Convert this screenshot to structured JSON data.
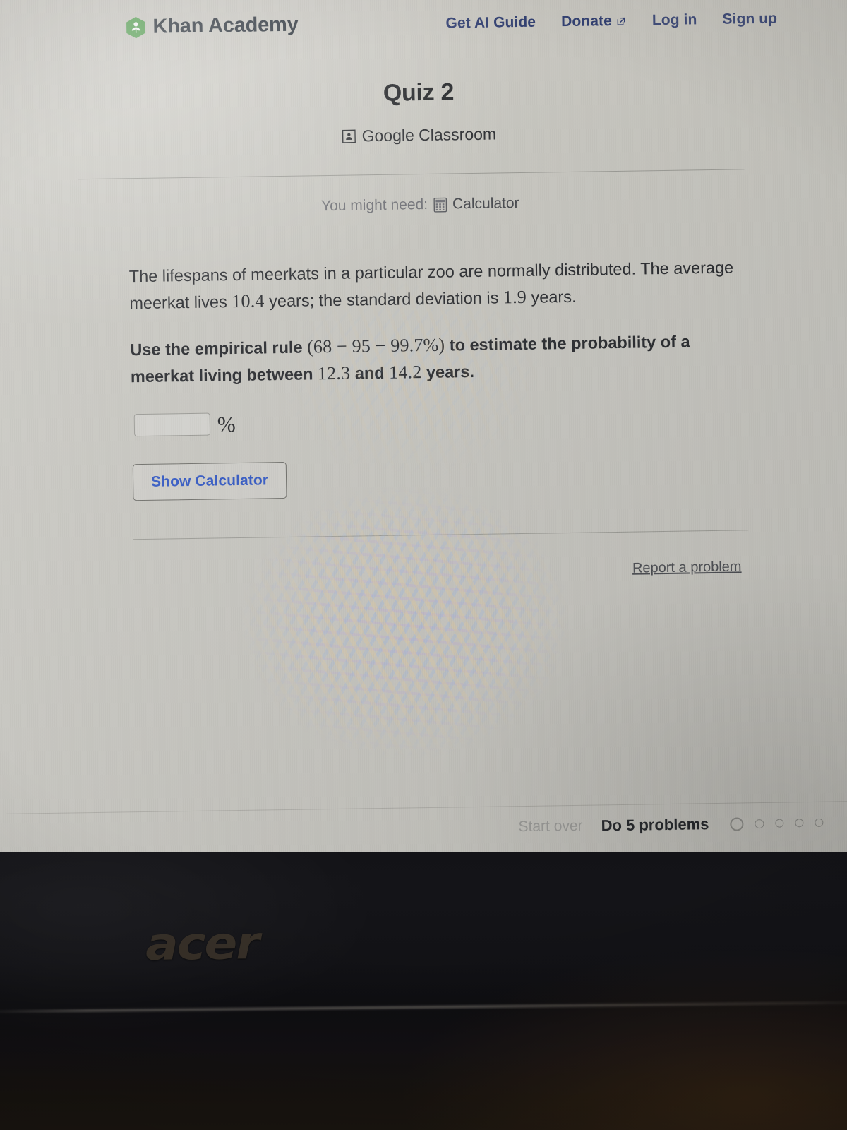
{
  "nav": {
    "brand": "Khan Academy",
    "brand_icon": "khan-academy-leaf-logo",
    "links": [
      {
        "label": "Get AI Guide",
        "icon": null
      },
      {
        "label": "Donate",
        "icon": "external-link-icon"
      },
      {
        "label": "Log in",
        "icon": null
      },
      {
        "label": "Sign up",
        "icon": null
      }
    ]
  },
  "exercise": {
    "title": "Quiz 2",
    "classroom_label": "Google Classroom",
    "classroom_icon": "google-classroom-icon",
    "need_prefix": "You might need:",
    "calculator_label": "Calculator",
    "calculator_icon": "calculator-icon",
    "problem": {
      "line1_a": "The lifespans of meerkats in a particular zoo are normally distributed. The average meerkat lives ",
      "mean": "10.4",
      "line1_b": " years; the standard deviation is ",
      "sd": "1.9",
      "line1_c": " years.",
      "line2_a": "Use the empirical rule ",
      "rule": "(68 − 95 − 99.7%)",
      "line2_b": " to estimate the probability of a meerkat living between ",
      "low": "12.3",
      "line2_c": " and ",
      "high": "14.2",
      "line2_d": " years."
    },
    "answer": {
      "value": "",
      "placeholder": "",
      "unit": "%"
    },
    "show_calculator_label": "Show Calculator",
    "report_label": "Report a problem"
  },
  "footer": {
    "start_over": "Start over",
    "do_problems": "Do 5 problems",
    "progress_dots": 5
  },
  "device": {
    "brand": "acer"
  },
  "colors": {
    "brand_green": "#53a14f",
    "nav_link": "#2b3a70",
    "link_blue": "#2f56c4",
    "screen_bg": "#c9c8c2",
    "text_dark": "#27292d",
    "muted": "#6f7076",
    "bezel": "#121216"
  }
}
